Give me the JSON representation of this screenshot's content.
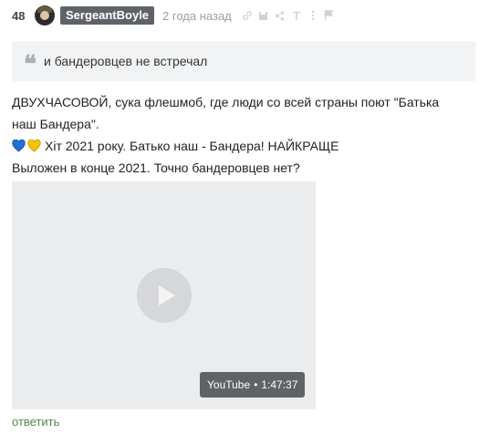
{
  "comment": {
    "rating": "48",
    "username": "SergeantBoyle",
    "time": "2 года назад",
    "quote": "и бандеровцев не встречал",
    "text_lines": [
      "ДВУХЧАСОВОЙ, сука флешмоб, где люди со всей страны поют \"Батька",
      "наш Бандера\".",
      "Хіт 2021 року. Батько наш - Бандера! НАЙКРАЩЕ",
      "Выложен в конце 2021. Точно бандеровцев нет?"
    ],
    "video": {
      "source": "YouTube",
      "separator": "•",
      "duration": "1:47:37"
    },
    "reply_label": "ответить"
  },
  "colors": {
    "badge": "#5f6368",
    "reply_link": "#4a8c3f",
    "heart_blue": "#1e6fd9",
    "heart_yellow": "#f5c400"
  },
  "icons": [
    "avatar",
    "link-icon",
    "save-icon",
    "share-icon",
    "text-icon",
    "more-icon",
    "flag-icon",
    "quote-icon",
    "blue-heart-icon",
    "yellow-heart-icon",
    "play-icon"
  ]
}
